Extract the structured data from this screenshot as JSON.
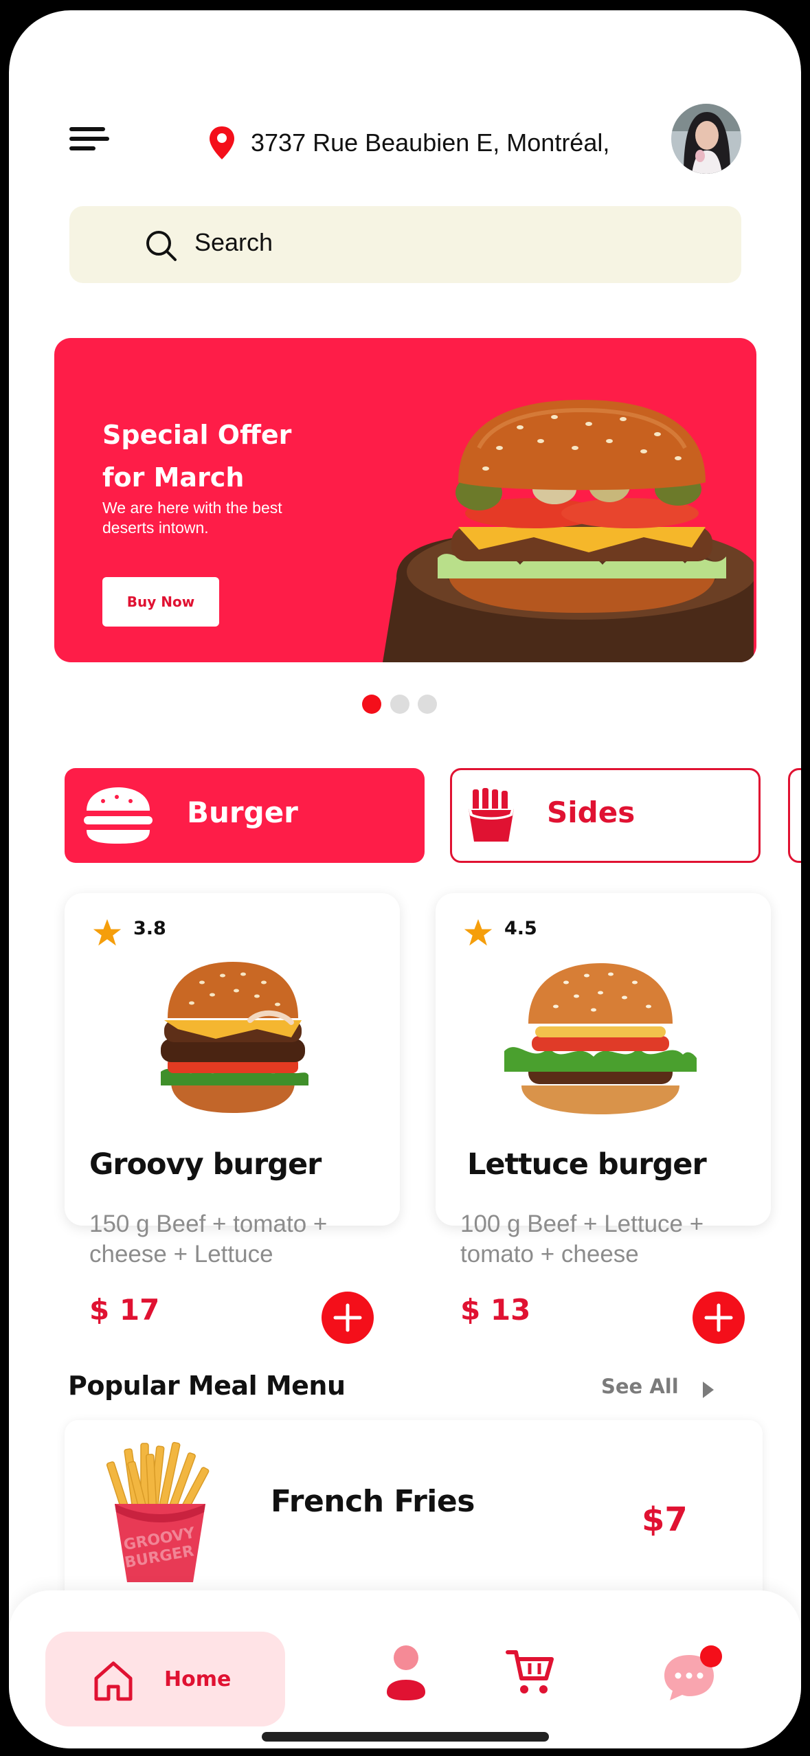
{
  "header": {
    "menu_icon": "hamburger-menu-icon",
    "location_icon": "map-pin-icon",
    "address": "3737 Rue Beaubien E, Montréal,",
    "avatar_icon": "user-avatar"
  },
  "search": {
    "icon": "search-icon",
    "placeholder": "Search"
  },
  "banner": {
    "title_line1": "Special Offer",
    "title_line2": "for March",
    "subtitle": "We are here with the best deserts intown.",
    "button_label": "Buy Now",
    "image_icon": "burger-on-wood-image"
  },
  "carousel": {
    "total_dots": 3,
    "active_index": 0
  },
  "categories": [
    {
      "label": "Burger",
      "icon": "burger-icon",
      "active": true
    },
    {
      "label": "Sides",
      "icon": "fries-icon",
      "active": false
    }
  ],
  "products": [
    {
      "rating": "3.8",
      "name": "Groovy burger",
      "desc_line1": "150 g Beef  + tomato +",
      "desc_line2": "cheese  + Lettuce",
      "price": "$ 17",
      "image_icon": "burger-image"
    },
    {
      "rating": "4.5",
      "name": "Lettuce burger",
      "desc_line1": "100 g Beef  + Lettuce +",
      "desc_line2": "tomato +  cheese",
      "price": "$ 13",
      "image_icon": "burger-image"
    }
  ],
  "popular": {
    "title": "Popular Meal Menu",
    "see_all": "See All",
    "items": [
      {
        "name": "French Fries",
        "price": "$7",
        "image_icon": "fries-image",
        "box_text": "GROOVY BURGER"
      }
    ]
  },
  "bottom_nav": {
    "items": [
      {
        "label": "Home",
        "icon": "home-icon",
        "active": true
      },
      {
        "label": "",
        "icon": "profile-icon",
        "active": false
      },
      {
        "label": "",
        "icon": "cart-icon",
        "active": false
      },
      {
        "label": "",
        "icon": "chat-icon",
        "active": false
      }
    ]
  },
  "colors": {
    "accent": "#fe1d48",
    "accent_dark": "#e01232",
    "search_bg": "#f6f4e3",
    "star": "#f59e0b",
    "dot_active": "#f40f1a",
    "dot_inactive": "#dddddd",
    "home_tab_bg": "#ffe3e6"
  }
}
